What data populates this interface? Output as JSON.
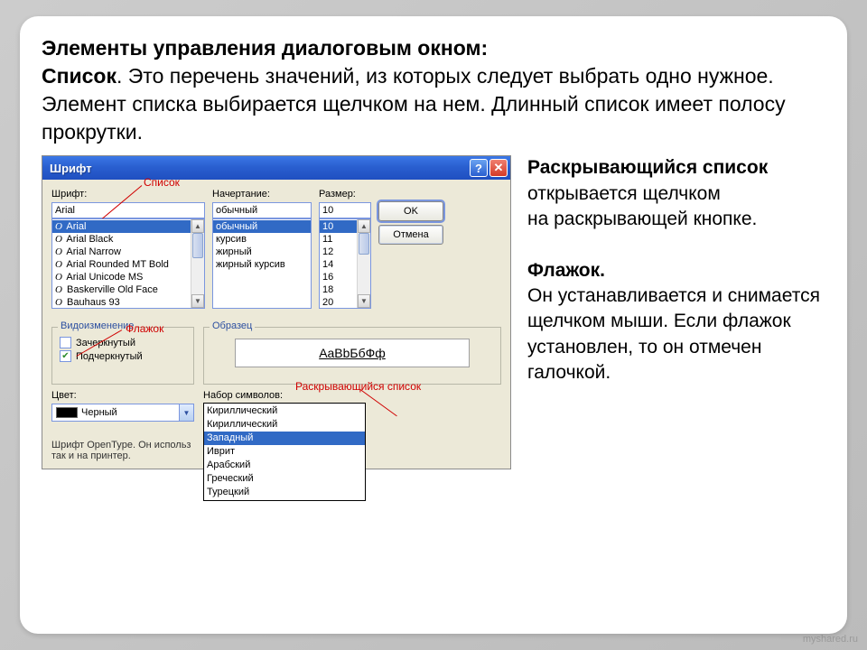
{
  "intro": {
    "heading": "Элементы управления диалоговым окном:",
    "subheading": "Список",
    "text": ". Это перечень значений, из которых следует выбрать одно нужное. Элемент списка выбирается щелчком на нем. Длинный список имеет полосу прокрутки."
  },
  "side": {
    "p1_bold": "Раскрывающийся список",
    "p1_rest": " открывается щелчком",
    "p1_line2": " на раскрывающей кнопке.",
    "p2_bold": "Флажок.",
    "p2_rest": "Он устанавливается и снимается щелчком мыши. Если флажок установлен, то он отмечен галочкой."
  },
  "dialog": {
    "title": "Шрифт",
    "font_label": "Шрифт:",
    "font_value": "Arial",
    "fonts": [
      "Arial",
      "Arial Black",
      "Arial Narrow",
      "Arial Rounded MT Bold",
      "Arial Unicode MS",
      "Baskerville Old Face",
      "Bauhaus 93"
    ],
    "style_label": "Начертание:",
    "style_value": "обычный",
    "styles": [
      "обычный",
      "курсив",
      "жирный",
      "жирный курсив"
    ],
    "size_label": "Размер:",
    "size_value": "10",
    "sizes": [
      "10",
      "11",
      "12",
      "14",
      "16",
      "18",
      "20"
    ],
    "ok": "OK",
    "cancel": "Отмена",
    "modif_legend": "Видоизменение",
    "chk_strike": "Зачеркнутый",
    "chk_underline": "Подчеркнутый",
    "sample_legend": "Образец",
    "sample_text": "AaBbБбФф",
    "color_label": "Цвет:",
    "color_value": "Черный",
    "charset_label": "Набор символов:",
    "charset_value": "Кириллический",
    "charsets": [
      "Кириллический",
      "Кириллический",
      "Западный",
      "Иврит",
      "Арабский",
      "Греческий",
      "Турецкий"
    ],
    "footer": "Шрифт OpenType. Он использ\nтак и на принтер."
  },
  "annot": {
    "list": "Список",
    "checkbox": "Флажок",
    "dropdown": "Раскрывающийся список"
  },
  "watermark": "myshared.ru"
}
